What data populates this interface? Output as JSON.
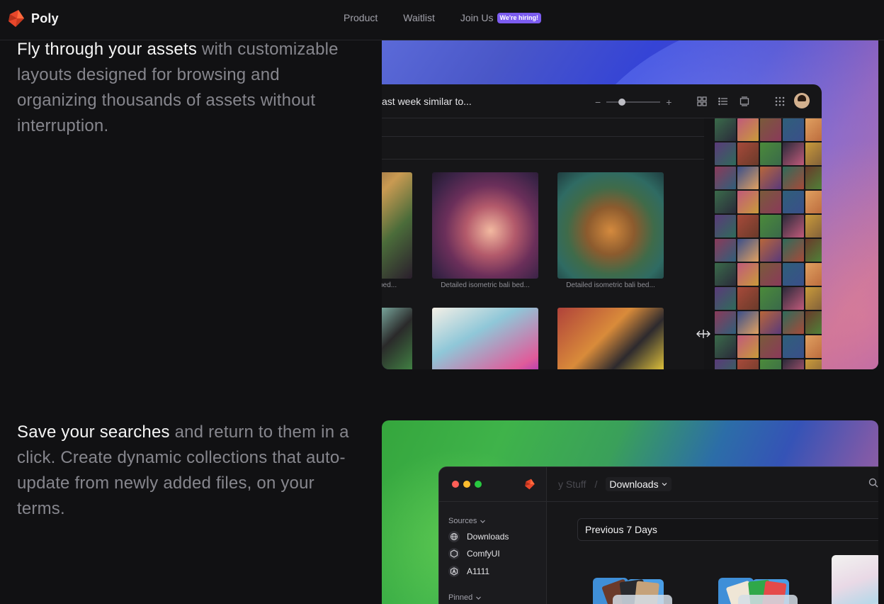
{
  "nav": {
    "brand": "Poly",
    "links": [
      "Product",
      "Waitlist",
      "Join Us"
    ],
    "hiring_badge": "We're hiring!"
  },
  "features": [
    {
      "title": "Fly through your assets",
      "body": " with customizable layouts designed for browsing and organizing thousands of assets without interruption."
    },
    {
      "title": "Save your searches",
      "body": " and return to them in a click. Create dynamic collections that auto-update from newly added files, on your terms."
    }
  ],
  "shot1": {
    "query": "ast week similar to...",
    "zoom_minus": "−",
    "zoom_plus": "+",
    "zoom_level": 0.29,
    "captions": [
      "li bed...",
      "Detailed isometric bali bed...",
      "Detailed isometric bali bed..."
    ]
  },
  "shot2": {
    "breadcrumb_prev": "y Stuff",
    "breadcrumb_sep": "/",
    "breadcrumb_current": "Downloads",
    "sources_label": "Sources",
    "sources": [
      {
        "label": "Downloads",
        "icon": "globe-icon"
      },
      {
        "label": "ComfyUI",
        "icon": "hexagon-icon"
      },
      {
        "label": "A1111",
        "icon": "a-badge-icon"
      }
    ],
    "pinned_label": "Pinned",
    "filter_value": "Previous 7 Days"
  },
  "colors": {
    "accent": "#7c5cf0",
    "logo": "#e8472b",
    "traffic_red": "#ff5f57",
    "traffic_yellow": "#febc2e",
    "traffic_green": "#28c840"
  }
}
